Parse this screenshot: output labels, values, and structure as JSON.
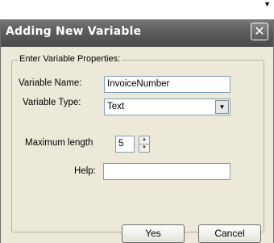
{
  "dialog": {
    "title": "Adding New Variable",
    "close_glyph": "✕",
    "group_label": "Enter Variable Properties:",
    "variable_name": {
      "label": "Variable Name:",
      "value": "InvoiceNumber"
    },
    "variable_type": {
      "label": "Variable Type:",
      "value": "Text"
    },
    "maximum_length": {
      "label": "Maximum length",
      "value": "5"
    },
    "help": {
      "label": "Help:",
      "value": ""
    },
    "buttons": {
      "yes": "Yes",
      "cancel": "Cancel"
    }
  },
  "icons": {
    "close": "close-icon",
    "dropdown": "chevron-down-icon",
    "spin_up": "spin-up-icon",
    "spin_down": "spin-down-icon"
  }
}
